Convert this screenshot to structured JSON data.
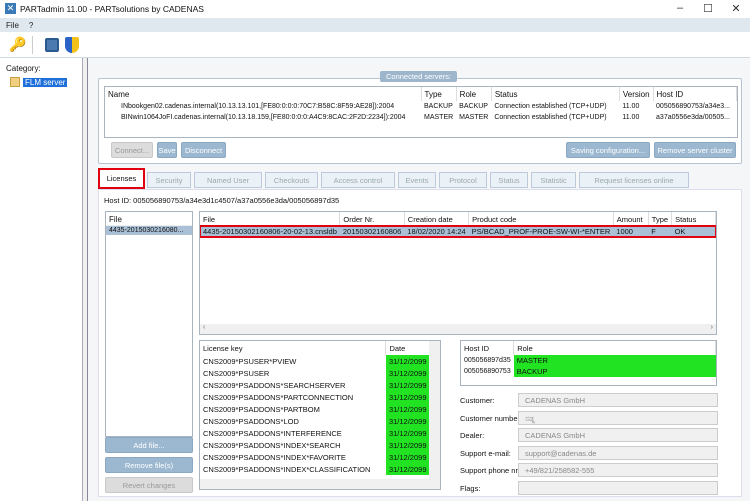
{
  "window": {
    "title": "PARTadmin 11.00 - PARTsolutions by CADENAS"
  },
  "menu": [
    "File",
    "?"
  ],
  "toolbar": {
    "icons": [
      "keys-icon",
      "save-icon",
      "shield-icon"
    ]
  },
  "category": {
    "label": "Category:",
    "items": [
      {
        "label": "FLM server",
        "selected": true
      }
    ]
  },
  "servers": {
    "title": "Connected servers:",
    "columns": [
      "Name",
      "Type",
      "Role",
      "Status",
      "Version",
      "Host ID"
    ],
    "rows": [
      [
        "INbookgen02.cadenas.internal(10.13.13.101,[FE80:0:0:0:70C7:B58C:8F59:AE28]):2004",
        "BACKUP",
        "BACKUP",
        "Connection established (TCP+UDP)",
        "11.00",
        "005056890753/a34e3..."
      ],
      [
        "BINwin1064JoFI.cadenas.internal(10.13.18.159,[FE80:0:0:0:A4C9:8CAC:2F2D:2234]):2004",
        "MASTER",
        "MASTER",
        "Connection established (TCP+UDP)",
        "11.00",
        "a37a0556e3da/00505..."
      ]
    ],
    "buttons": {
      "connect": "Connect...",
      "save": "Save",
      "disconnect": "Disconnect",
      "saving": "Saving configuration...",
      "remove": "Remove server cluster"
    }
  },
  "tabs": [
    "Licenses",
    "Security",
    "Named User",
    "Checkouts",
    "Access control",
    "Events",
    "Protocol",
    "Status",
    "Statistic",
    "Request licenses online"
  ],
  "active_tab": "Licenses",
  "licenses": {
    "host_id": "Host ID:  005056890753/a34e3d1c4507/a37a0556e3da/005056897d35",
    "file_list": {
      "header": "File",
      "items": [
        "4435-2015030216080..."
      ]
    },
    "buttons": {
      "add": "Add file...",
      "remove": "Remove file(s)",
      "revert": "Revert changes"
    },
    "files": {
      "columns": [
        "File",
        "Order Nr.",
        "Creation date",
        "Product code",
        "Amount",
        "Type",
        "Status"
      ],
      "rows": [
        [
          "4435-20150302160806-20-02-13.cnsldb",
          "20150302160806",
          "18/02/2020 14:24",
          "PS/BCAD_PROF-PROE-SW-WI-*ENTER",
          "1000",
          "F",
          "OK"
        ]
      ]
    },
    "keys": {
      "columns": [
        "License key",
        "Date"
      ],
      "rows": [
        [
          "CNS2009*PSUSER*PVIEW",
          "31/12/2099"
        ],
        [
          "CNS2009*PSUSER",
          "31/12/2099"
        ],
        [
          "CNS2009*PSADDONS*SEARCHSERVER",
          "31/12/2099"
        ],
        [
          "CNS2009*PSADDONS*PARTCONNECTION",
          "31/12/2099"
        ],
        [
          "CNS2009*PSADDONS*PARTBOM",
          "31/12/2099"
        ],
        [
          "CNS2009*PSADDONS*LOD",
          "31/12/2099"
        ],
        [
          "CNS2009*PSADDONS*INTERFERENCE",
          "31/12/2099"
        ],
        [
          "CNS2009*PSADDONS*INDEX*SEARCH",
          "31/12/2099"
        ],
        [
          "CNS2009*PSADDONS*INDEX*FAVORITE",
          "31/12/2099"
        ],
        [
          "CNS2009*PSADDONS*INDEX*CLASSIFICATION",
          "31/12/2099"
        ]
      ]
    },
    "hosts": {
      "columns": [
        "Host ID",
        "Role"
      ],
      "rows": [
        [
          "005056897d35",
          "MASTER"
        ],
        [
          "005056890753",
          "BACKUP"
        ]
      ]
    },
    "fields": [
      {
        "label": "Customer:",
        "value": "CADENAS GmbH"
      },
      {
        "label": "Customer number:",
        "value": "ಸಡ್ನ"
      },
      {
        "label": "Dealer:",
        "value": "CADENAS GmbH"
      },
      {
        "label": "Support e-mail:",
        "value": "support@cadenas.de"
      },
      {
        "label": "Support phone nr.:",
        "value": "+49/821/258582-555"
      },
      {
        "label": "Flags:",
        "value": ""
      }
    ]
  },
  "colors": {
    "valid": "#22e322",
    "selection": "#a9c0d6",
    "highlight": "#e0000f"
  }
}
